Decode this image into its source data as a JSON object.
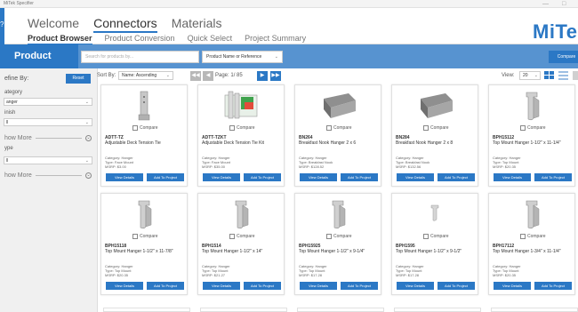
{
  "window": {
    "title": "MiTek Specifier",
    "controls": [
      "—",
      "□"
    ]
  },
  "nav": {
    "main_tabs": [
      {
        "label": "Welcome"
      },
      {
        "label": "Connectors"
      },
      {
        "label": "Materials"
      }
    ],
    "sub_tabs": [
      {
        "label": "Product Browser"
      },
      {
        "label": "Product Conversion"
      },
      {
        "label": "Quick Select"
      },
      {
        "label": "Project Summary"
      }
    ],
    "logo": "MiTek",
    "left_strip_glyph": "?"
  },
  "header": {
    "title": "Product Browser",
    "search_placeholder": "Search for products by...",
    "search_type": "Product Name or Reference",
    "compare_label": "Compare"
  },
  "sidebar": {
    "refine_label": "efine By:",
    "reset_label": "Reset",
    "filters": [
      {
        "label": "ategory",
        "value": "anger"
      },
      {
        "label": "inish",
        "value": "ll"
      }
    ],
    "show_more_1": "how More",
    "type_label": "ype",
    "type_value": "ll",
    "show_more_2": "how More",
    "show_more_icon": "⌄"
  },
  "toolbar": {
    "sort_label": "Sort By:",
    "sort_value": "Name: Ascending",
    "page_label": "Page:",
    "page_value": "1/ 85",
    "view_label": "View:",
    "view_value": "20",
    "first_icon": "◀◀",
    "prev_icon": "◀",
    "next_icon": "▶",
    "last_icon": "▶▶"
  },
  "card_labels": {
    "compare": "Compare",
    "view_details": "View Details",
    "add_to_project": "Add To Project"
  },
  "products": [
    {
      "code": "ADTT-TZ",
      "name": "Adjustable Deck Tension Tie",
      "category": "Category: Hanger",
      "type": "Type: Face Mount",
      "msrp": "MSRP: $3.00",
      "img": "tension-tie"
    },
    {
      "code": "ADTT-TZKT",
      "name": "Adjustable Deck Tension Tie Kit",
      "category": "Category: Hanger",
      "type": "Type: Face Mount",
      "msrp": "MSRP: $35.00",
      "img": "kit"
    },
    {
      "code": "BN264",
      "name": "Breakfast Nook Hanger 2 x 6",
      "category": "Category: Hanger",
      "type": "Type: Breakfast Nook",
      "msrp": "MSRP: $128.52",
      "img": "nook"
    },
    {
      "code": "BN284",
      "name": "Breakfast Nook Hanger 2 x 8",
      "category": "Category: Hanger",
      "type": "Type: Breakfast Nook",
      "msrp": "MSRP: $132.56",
      "img": "nook"
    },
    {
      "code": "BPH15112",
      "name": "Top Mount Hanger 1-1/2\" x 11-1/4\"",
      "category": "Category: Hanger",
      "type": "Type: Top Mount",
      "msrp": "MSRP: $20.35",
      "img": "topmount"
    },
    {
      "code": "BPH15118",
      "name": "Top Mount Hanger 1-1/2\" x 11-7/8\"",
      "category": "Category: Hanger",
      "type": "Type: Top Mount",
      "msrp": "MSRP: $20.35",
      "img": "topmount"
    },
    {
      "code": "BPH1514",
      "name": "Top Mount Hanger 1-1/2\" x 14\"",
      "category": "Category: Hanger",
      "type": "Type: Top Mount",
      "msrp": "MSRP: $21.27",
      "img": "topmount"
    },
    {
      "code": "BPH15925",
      "name": "Top Mount Hanger 1-1/2\" x 9-1/4\"",
      "category": "Category: Hanger",
      "type": "Type: Top Mount",
      "msrp": "MSRP: $17.28",
      "img": "topmount"
    },
    {
      "code": "BPH1595",
      "name": "Top Mount Hanger 1-1/2\" x 9-1/2\"",
      "category": "Category: Hanger",
      "type": "Type: Top Mount",
      "msrp": "MSRP: $17.28",
      "img": "topmount-small"
    },
    {
      "code": "BPH17112",
      "name": "Top Mount Hanger 1-3/4\" x 11-1/4\"",
      "category": "Category: Hanger",
      "type": "Type: Top Mount",
      "msrp": "MSRP: $20.35",
      "img": "topmount"
    }
  ],
  "colors": {
    "accent": "#2b78c5",
    "bar": "#5793d0",
    "sidebar": "#f0f0f0"
  }
}
